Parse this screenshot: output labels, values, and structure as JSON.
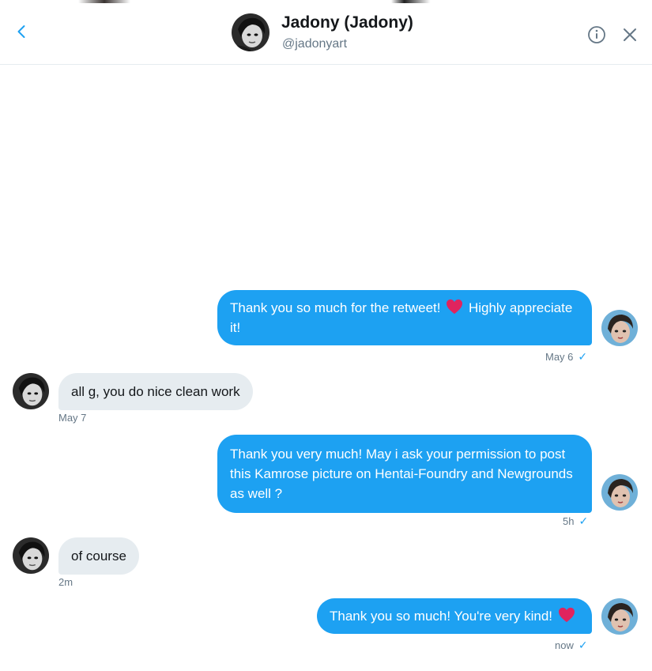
{
  "header": {
    "name": "Jadony (Jadony)",
    "handle": "@jadonyart"
  },
  "messages": [
    {
      "direction": "out",
      "text_before": "Thank you so much for the retweet!",
      "text_after": "Highly appreciate it!",
      "has_heart": true,
      "time": "May 6",
      "seen": "✓"
    },
    {
      "direction": "in",
      "text": "all g, you do nice clean work",
      "time": "May 7"
    },
    {
      "direction": "out",
      "text": "Thank you very much! May i ask your permission to post this Kamrose picture on Hentai-Foundry and Newgrounds as well ?",
      "time": "5h",
      "seen": "✓"
    },
    {
      "direction": "in",
      "text": "of course",
      "time": "2m"
    },
    {
      "direction": "out",
      "text": "Thank you so much! You're very kind!",
      "has_heart": true,
      "time": "now",
      "seen": "✓"
    }
  ],
  "colors": {
    "accent": "#1da1f2",
    "incoming_bubble": "#e6ecf0",
    "heart": "#e0245e",
    "muted_text": "#657786"
  },
  "icons": {
    "back": "chevron-left-icon",
    "info": "info-icon",
    "close": "close-icon",
    "heart": "heart-icon"
  }
}
